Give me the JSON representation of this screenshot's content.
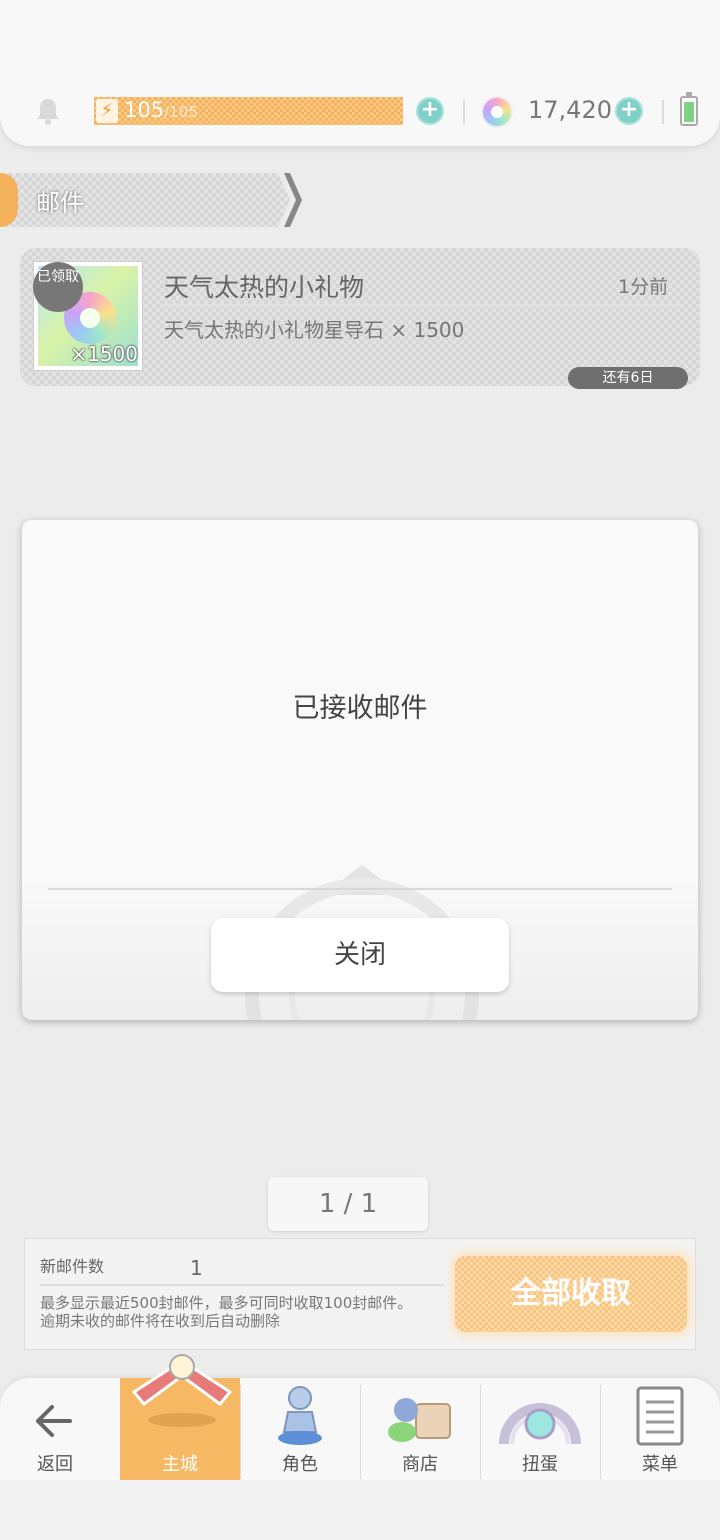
{
  "status_bar": {
    "energy_current": "105",
    "energy_max": "/105",
    "gem_count": "17,420",
    "plus_symbol": "+"
  },
  "mail_header": {
    "title": "邮件"
  },
  "mail_list": [
    {
      "badge": "已领取",
      "title": "天气太热的小礼物",
      "time": "1分前",
      "description": "天气太热的小礼物星导石 × 1500",
      "quantity": "×1500",
      "expire": "还有6日"
    }
  ],
  "dialog": {
    "message": "已接收邮件",
    "close_label": "关闭"
  },
  "pager": {
    "text": "1 / 1"
  },
  "info_panel": {
    "new_mail_label": "新邮件数",
    "new_mail_count": "1",
    "note_line1": "最多显示最近500封邮件，最多可同时收取100封邮件。",
    "note_line2": "逾期未收的邮件将在收到后自动删除",
    "collect_all_label": "全部收取"
  },
  "nav": {
    "back": "返回",
    "items": [
      {
        "label": "主城",
        "icon": "castle-icon"
      },
      {
        "label": "角色",
        "icon": "character-icon"
      },
      {
        "label": "商店",
        "icon": "shop-icon"
      },
      {
        "label": "扭蛋",
        "icon": "gacha-icon"
      },
      {
        "label": "菜单",
        "icon": "menu-list-icon"
      }
    ]
  },
  "colors": {
    "accent_orange": "#f4b25c",
    "teal": "#7fd0c7",
    "background": "#ececec"
  }
}
